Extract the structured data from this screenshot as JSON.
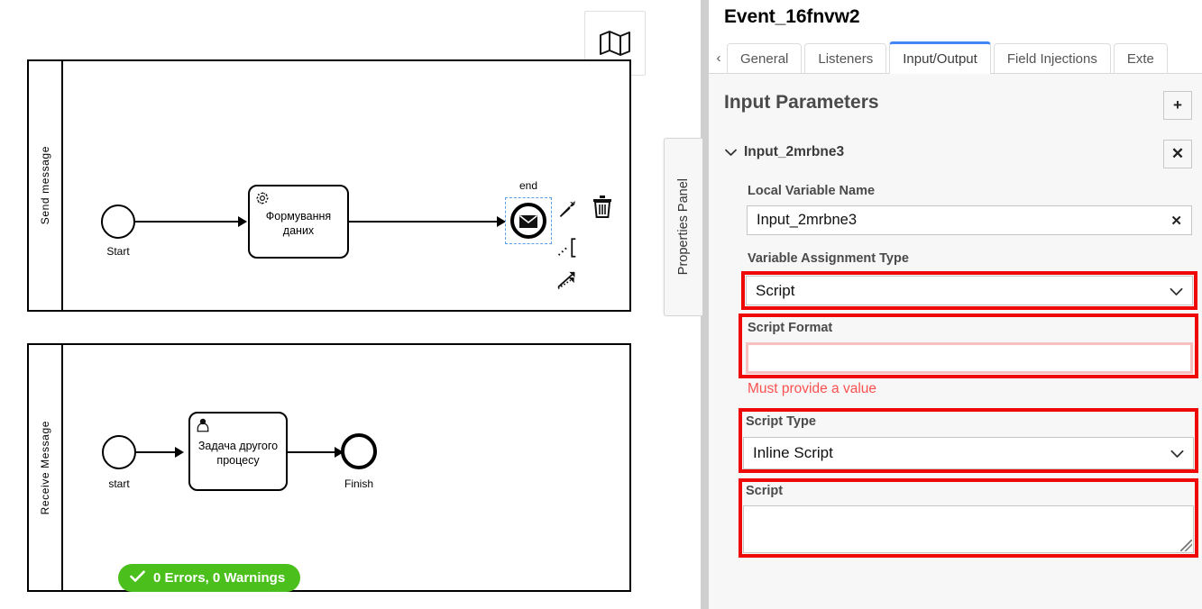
{
  "canvas": {
    "minimap_icon": "map-icon",
    "validation_badge": {
      "icon": "check-icon",
      "text": "0 Errors, 0 Warnings",
      "color": "#4bc01d"
    },
    "pools": [
      {
        "lane_label": "Send message",
        "elements": [
          {
            "type": "start-event",
            "label": "Start"
          },
          {
            "type": "service-task",
            "label": "Формування даних",
            "icon": "gear-icon"
          },
          {
            "type": "message-end-event",
            "label": "end",
            "icon": "envelope-icon",
            "selected": true
          }
        ],
        "context_pad": [
          {
            "icon": "wrench-icon",
            "name": "wrench-icon"
          },
          {
            "icon": "trash-icon",
            "name": "trash-icon"
          },
          {
            "icon": "append-icon",
            "name": "append-icon"
          },
          {
            "icon": "connect-icon",
            "name": "connect-icon"
          }
        ]
      },
      {
        "lane_label": "Receive Message",
        "elements": [
          {
            "type": "start-event",
            "label": "start"
          },
          {
            "type": "user-task",
            "label": "Задача другого процесу",
            "icon": "user-icon"
          },
          {
            "type": "end-event",
            "label": "Finish"
          }
        ]
      }
    ]
  },
  "properties_panel_tab": {
    "label": "Properties Panel"
  },
  "panel": {
    "title": "Event_16fnvw2",
    "tabs": {
      "scroll_left_icon": "chevron-left-icon",
      "items": [
        {
          "label": "General",
          "active": false
        },
        {
          "label": "Listeners",
          "active": false
        },
        {
          "label": "Input/Output",
          "active": true
        },
        {
          "label": "Field Injections",
          "active": false
        },
        {
          "label": "Exte",
          "active": false
        }
      ],
      "active_accent": "#4285f4"
    },
    "section": {
      "title": "Input Parameters",
      "add_label": "+",
      "remove_label": "✕",
      "item": {
        "chevron": "⌄",
        "name": "Input_2mrbne3"
      },
      "fields": [
        {
          "label": "Local Variable Name",
          "type": "text",
          "value": "Input_2mrbne3",
          "clear_label": "✕",
          "invalid": false,
          "highlighted": false
        },
        {
          "label": "Variable Assignment Type",
          "type": "select",
          "value": "Script",
          "caret": "⌄",
          "invalid": false,
          "highlighted": true
        },
        {
          "label": "Script Format",
          "type": "text",
          "value": "",
          "invalid": true,
          "highlighted": true,
          "error": "Must provide a value"
        },
        {
          "label": "Script Type",
          "type": "select",
          "value": "Inline Script",
          "caret": "⌄",
          "invalid": false,
          "highlighted": true
        },
        {
          "label": "Script",
          "type": "textarea",
          "value": "",
          "invalid": false,
          "highlighted": true
        }
      ]
    }
  },
  "colors": {
    "annotation_red": "#ef0808",
    "error_text": "#fb5151",
    "tab_accent": "#4285f4",
    "badge_green": "#4bc01d"
  }
}
